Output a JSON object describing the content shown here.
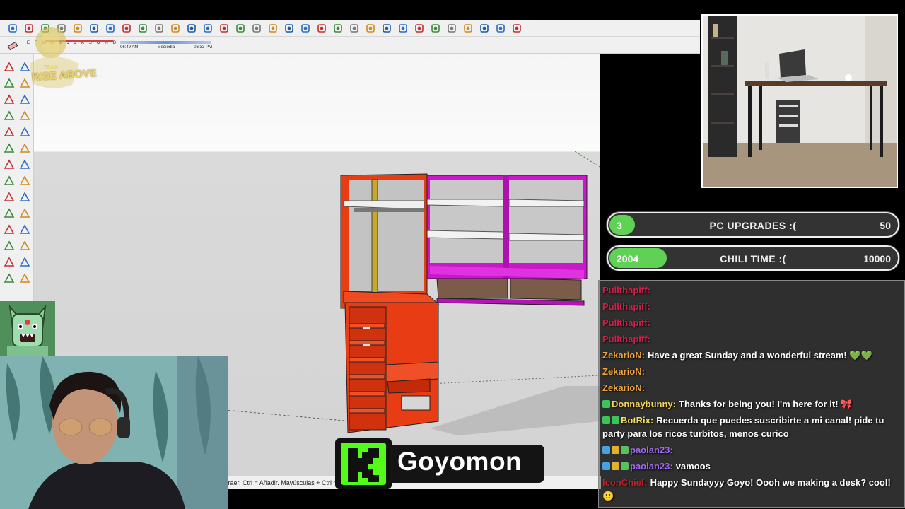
{
  "toolbar": {
    "icons": [
      "select-icon",
      "eraser-icon",
      "paint-icon",
      "lasso-icon",
      "rectangle-icon",
      "move-icon",
      "rotate-icon",
      "scale-icon",
      "tape-icon",
      "text-icon",
      "paint-bucket-icon",
      "orbit-icon",
      "walk-icon",
      "zoom-icon",
      "zoom-extents-icon",
      "section-icon",
      "layers-icon",
      "styles-icon",
      "user-icon",
      "component-icon",
      "warehouse-icon",
      "home-icon",
      "house-icon",
      "extension-icon",
      "iso-view-icon",
      "top-view-icon",
      "front-view-icon",
      "right-view-icon",
      "back-view-icon",
      "left-view-icon",
      "xray-icon",
      "wireframe-icon"
    ],
    "accent": "#2b6cc4"
  },
  "shadows": {
    "months": [
      "E",
      "F",
      "M",
      "A",
      "M",
      "J",
      "J",
      "A",
      "S",
      "O",
      "N",
      "D"
    ],
    "time_start": "06:49 AM",
    "time_mid": "Mediodía",
    "time_end": "06:33 PM"
  },
  "team_logo": {
    "text": "RISE ABOVE",
    "small": "TEAM"
  },
  "status_text": "traer. Ctrl = Añadir. Mayúsculas + Ctrl = ",
  "goals": [
    {
      "current": "3",
      "title": "PC UPGRADES :(",
      "target": "50",
      "fraction": 0.06
    },
    {
      "current": "2004",
      "title": "CHILI TIME :(",
      "target": "10000",
      "fraction": 0.2
    }
  ],
  "chat": [
    {
      "user": "Pullthapiff:",
      "color": "#d0204a",
      "text": "",
      "badges": []
    },
    {
      "user": "Pullthapiff:",
      "color": "#d0204a",
      "text": "",
      "badges": []
    },
    {
      "user": "Pullthapiff:",
      "color": "#d0204a",
      "text": "",
      "badges": []
    },
    {
      "user": "Pullthapiff:",
      "color": "#d0204a",
      "text": "",
      "badges": []
    },
    {
      "user": "ZekarioN:",
      "color": "#f2a53a",
      "text": "Have a great Sunday and a wonderful stream! 💚💚",
      "badges": []
    },
    {
      "user": "ZekarioN:",
      "color": "#f2a53a",
      "text": "",
      "badges": []
    },
    {
      "user": "ZekarioN:",
      "color": "#f2a53a",
      "text": "",
      "badges": []
    },
    {
      "user": "Donnaybunny:",
      "color": "#f3d35a",
      "text": "Thanks for being you! I'm here for it! 🎀",
      "badges": [
        "#3ac45a"
      ]
    },
    {
      "user": "BotRix:",
      "color": "#f0e060",
      "text": "Recuerda que puedes suscribirte a mi canal! pide tu party para los ricos turbitos, menos curico",
      "badges": [
        "#3ac45a",
        "#3ac45a"
      ]
    },
    {
      "user": "paolan23:",
      "color": "#a06cf0",
      "text": "",
      "badges": [
        "#4aa0e0",
        "#e0b030",
        "#58c060"
      ]
    },
    {
      "user": "paolan23:",
      "color": "#a06cf0",
      "text": "vamoos",
      "badges": [
        "#4aa0e0",
        "#e0b030",
        "#58c060"
      ]
    },
    {
      "user": "IconChief:",
      "color": "#c0202a",
      "text": "Happy Sundayyy Goyo! Oooh we making a desk? cool! 🙂",
      "badges": []
    }
  ],
  "streamer": {
    "name": "Goyomon",
    "brand_color": "#53fc18"
  }
}
